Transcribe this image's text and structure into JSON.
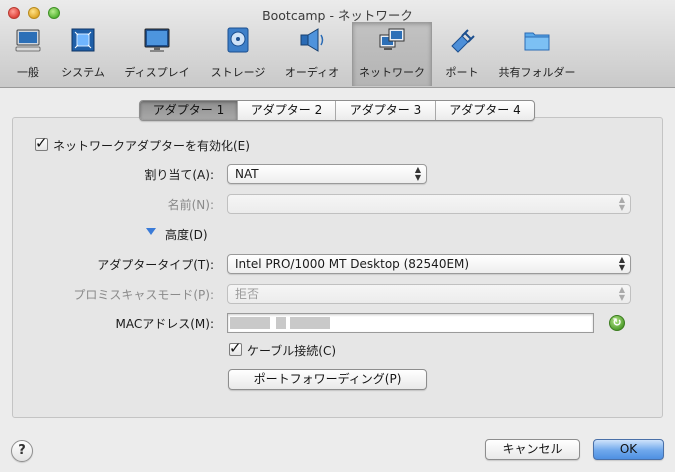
{
  "window": {
    "title": "Bootcamp - ネットワーク"
  },
  "toolbar": {
    "items": [
      {
        "label": "一般",
        "icon": "monitor-general-icon"
      },
      {
        "label": "システム",
        "icon": "chip-system-icon"
      },
      {
        "label": "ディスプレイ",
        "icon": "display-icon"
      },
      {
        "label": "ストレージ",
        "icon": "disk-storage-icon"
      },
      {
        "label": "オーディオ",
        "icon": "speaker-audio-icon"
      },
      {
        "label": "ネットワーク",
        "icon": "network-icon",
        "selected": true
      },
      {
        "label": "ポート",
        "icon": "port-plug-icon"
      },
      {
        "label": "共有フォルダー",
        "icon": "shared-folder-icon"
      }
    ]
  },
  "tabs": [
    {
      "label": "アダプター 1",
      "active": true
    },
    {
      "label": "アダプター 2"
    },
    {
      "label": "アダプター 3"
    },
    {
      "label": "アダプター 4"
    }
  ],
  "form": {
    "enable_adapter": {
      "label": "ネットワークアダプターを有効化(E)",
      "checked": true
    },
    "attached_to": {
      "label": "割り当て(A):",
      "value": "NAT"
    },
    "name": {
      "label": "名前(N):",
      "value": ""
    },
    "advanced": {
      "label": "高度(D)"
    },
    "adapter_type": {
      "label": "アダプタータイプ(T):",
      "value": "Intel PRO/1000 MT Desktop (82540EM)"
    },
    "promiscuous": {
      "label": "プロミスキャスモード(P):",
      "value": "拒否"
    },
    "mac": {
      "label": "MACアドレス(M):"
    },
    "cable": {
      "label": "ケーブル接続(C)",
      "checked": true
    },
    "port_forwarding": {
      "label": "ポートフォワーディング(P)"
    }
  },
  "footer": {
    "help": "?",
    "cancel": "キャンセル",
    "ok": "OK"
  },
  "colors": {
    "accent": "#4f90e2",
    "disclosure": "#3a7bd8",
    "refresh": "#4c9a2a"
  }
}
